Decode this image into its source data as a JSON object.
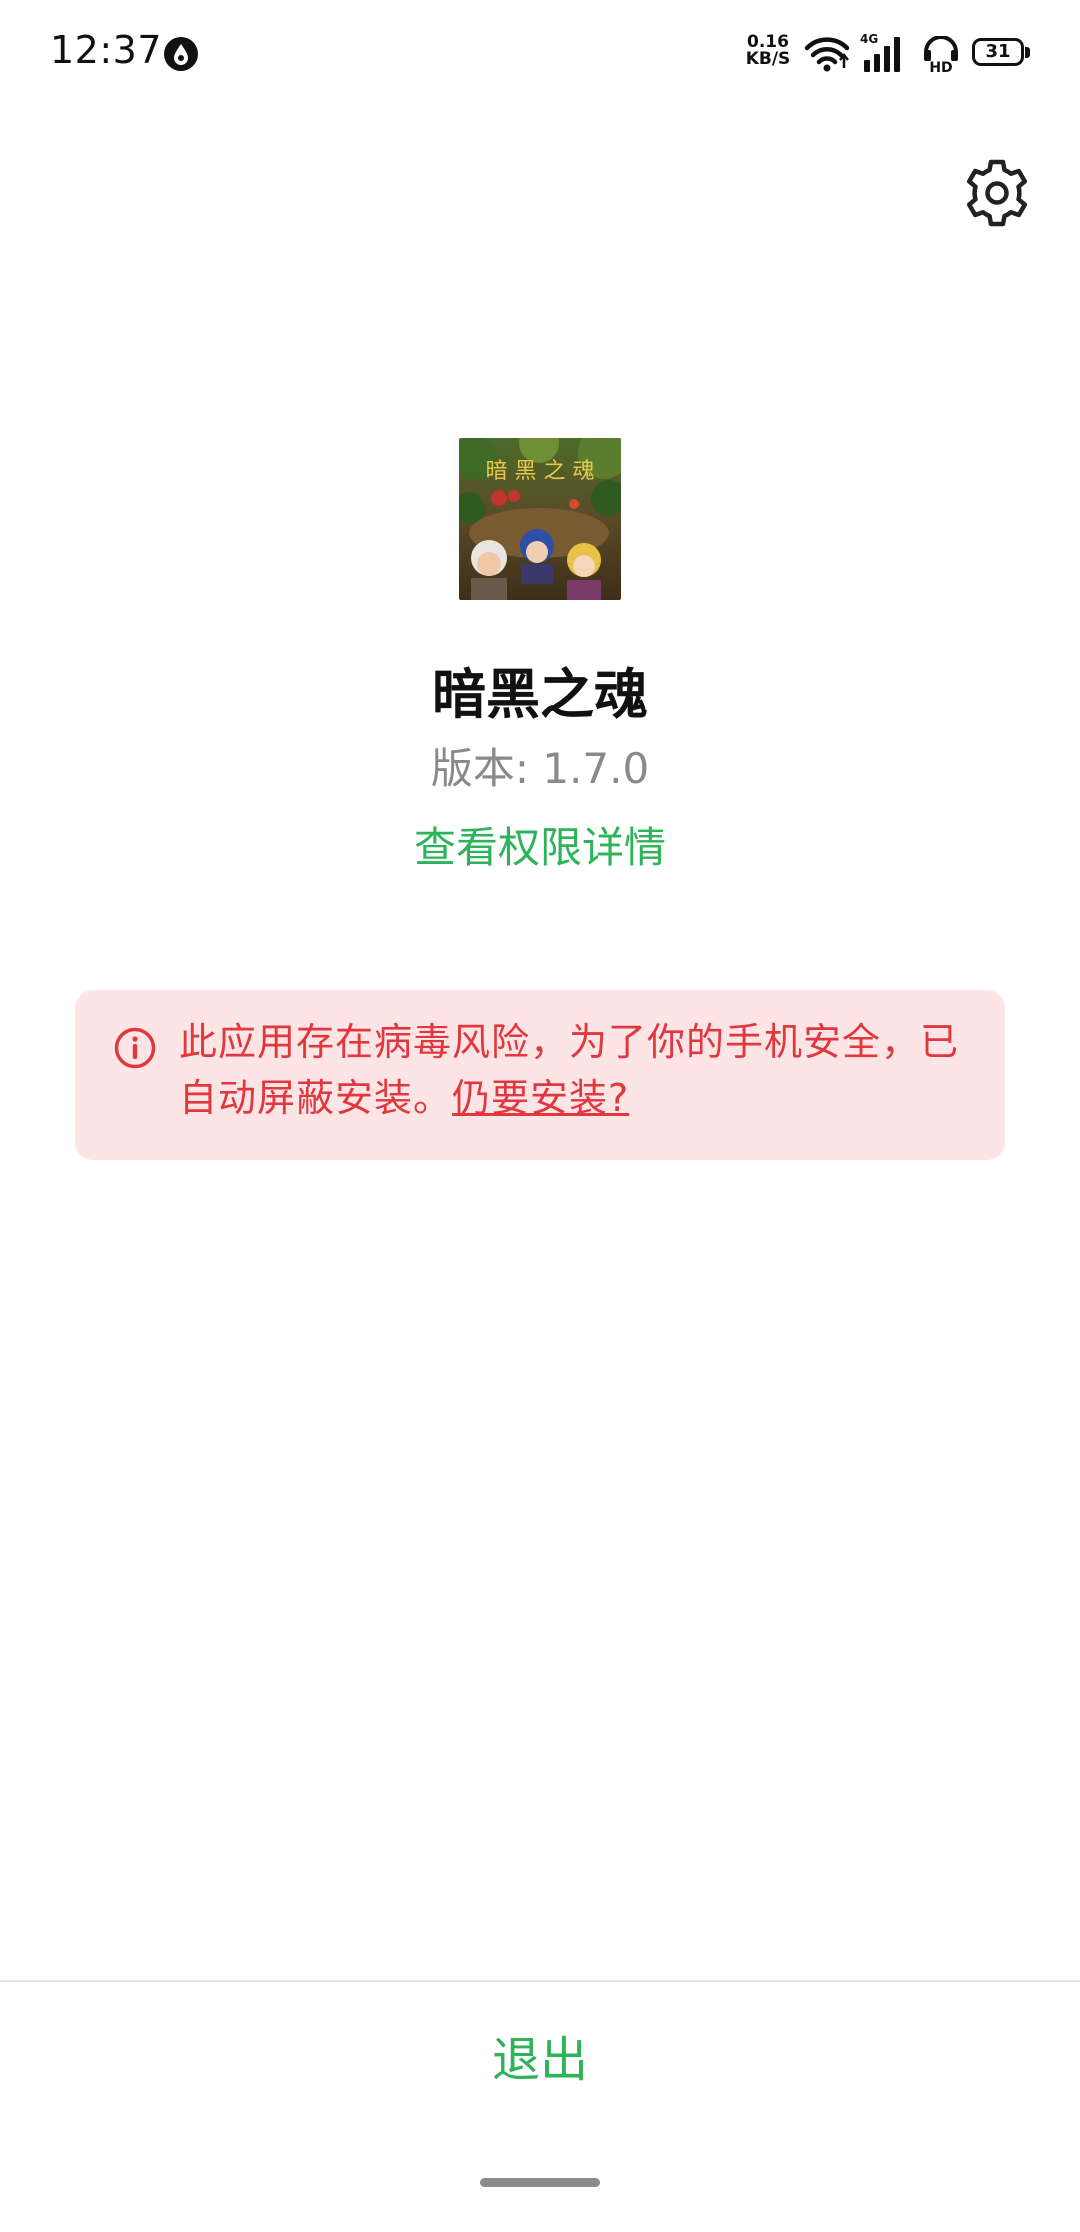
{
  "status_bar": {
    "time": "12:37",
    "net_speed_value": "0.16",
    "net_speed_unit": "KB/S",
    "network_type": "4G",
    "hd_label": "HD",
    "battery": "31"
  },
  "app": {
    "name": "暗黑之魂",
    "version_label": "版本: 1.7.0",
    "permission_link": "查看权限详情"
  },
  "warning": {
    "message": "此应用存在病毒风险，为了你的手机安全，已自动屏蔽安装。",
    "install_link": "仍要安装?",
    "color": "#e0383e",
    "background": "#fde5e6"
  },
  "footer": {
    "exit_label": "退出"
  },
  "colors": {
    "accent_green": "#2db359",
    "text_gray": "#8a8a8a"
  },
  "icons": {
    "settings": "gear-icon",
    "warning": "info-circle-icon"
  }
}
